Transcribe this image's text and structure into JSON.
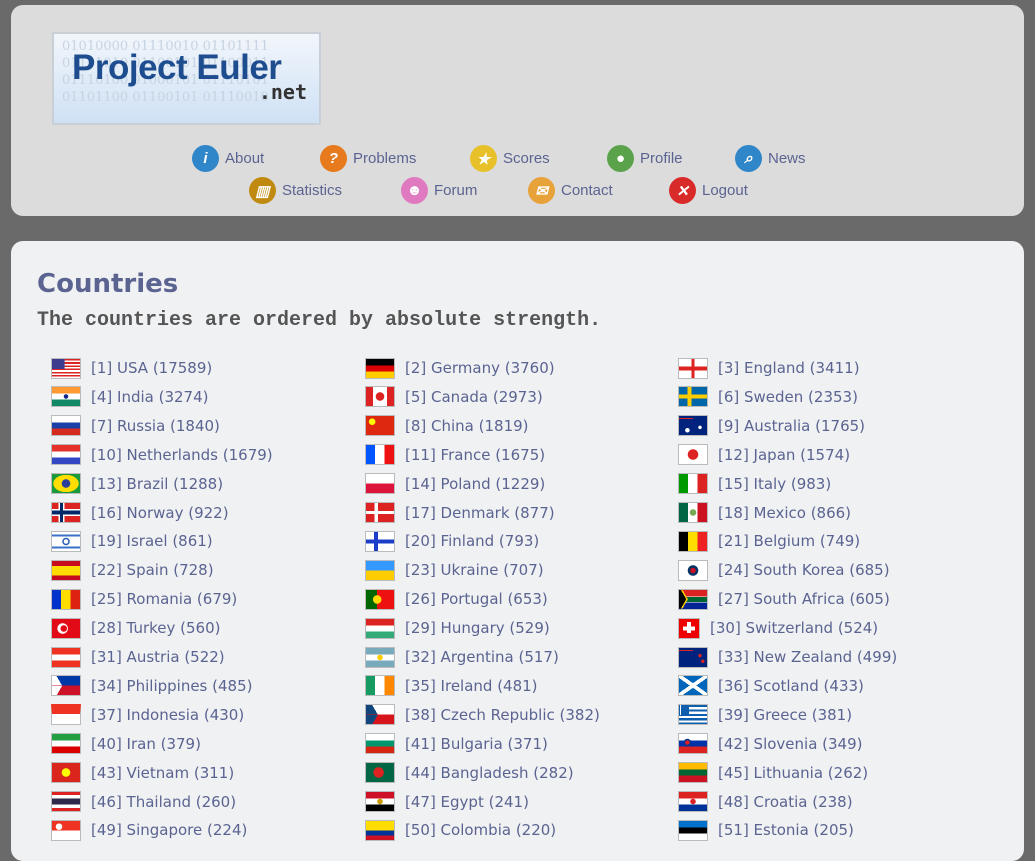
{
  "logo": {
    "title": "Project Euler",
    "suffix": ".net",
    "binary": "01010000 01110010 01101111\n01101010 01100101 01100011\n01110100 01000101 01110101\n01101100 01100101 01110010"
  },
  "nav": [
    {
      "label": "About",
      "icon": "info-icon",
      "color": "#2f86c8",
      "glyph": "i"
    },
    {
      "label": "Problems",
      "icon": "question-icon",
      "color": "#e67a1c",
      "glyph": "?"
    },
    {
      "label": "Scores",
      "icon": "star-icon",
      "color": "#e8c12a",
      "glyph": "★"
    },
    {
      "label": "Profile",
      "icon": "user-icon",
      "color": "#5aa34a",
      "glyph": "●"
    },
    {
      "label": "News",
      "icon": "magnifier-icon",
      "color": "#2f86c8",
      "glyph": "⌕"
    },
    {
      "label": "Statistics",
      "icon": "chart-icon",
      "color": "#c08a10",
      "glyph": "▥"
    },
    {
      "label": "Forum",
      "icon": "users-icon",
      "color": "#e07ac0",
      "glyph": "☻"
    },
    {
      "label": "Contact",
      "icon": "envelope-icon",
      "color": "#e8a23a",
      "glyph": "✉"
    },
    {
      "label": "Logout",
      "icon": "close-icon",
      "color": "#d92a2a",
      "glyph": "✕"
    }
  ],
  "page": {
    "title": "Countries",
    "subtitle": "The countries are ordered by absolute strength."
  },
  "countries": [
    {
      "text": "[1] USA (17589)",
      "flag": "us"
    },
    {
      "text": "[2] Germany (3760)",
      "flag": "de"
    },
    {
      "text": "[3] England (3411)",
      "flag": "eng"
    },
    {
      "text": "[4] India (3274)",
      "flag": "in"
    },
    {
      "text": "[5] Canada (2973)",
      "flag": "ca"
    },
    {
      "text": "[6] Sweden (2353)",
      "flag": "se"
    },
    {
      "text": "[7] Russia (1840)",
      "flag": "ru"
    },
    {
      "text": "[8] China (1819)",
      "flag": "cn"
    },
    {
      "text": "[9] Australia (1765)",
      "flag": "au"
    },
    {
      "text": "[10] Netherlands (1679)",
      "flag": "nl"
    },
    {
      "text": "[11] France (1675)",
      "flag": "fr"
    },
    {
      "text": "[12] Japan (1574)",
      "flag": "jp"
    },
    {
      "text": "[13] Brazil (1288)",
      "flag": "br"
    },
    {
      "text": "[14] Poland (1229)",
      "flag": "pl"
    },
    {
      "text": "[15] Italy (983)",
      "flag": "it"
    },
    {
      "text": "[16] Norway (922)",
      "flag": "no"
    },
    {
      "text": "[17] Denmark (877)",
      "flag": "dk"
    },
    {
      "text": "[18] Mexico (866)",
      "flag": "mx"
    },
    {
      "text": "[19] Israel (861)",
      "flag": "il"
    },
    {
      "text": "[20] Finland (793)",
      "flag": "fi"
    },
    {
      "text": "[21] Belgium (749)",
      "flag": "be"
    },
    {
      "text": "[22] Spain (728)",
      "flag": "es"
    },
    {
      "text": "[23] Ukraine (707)",
      "flag": "ua"
    },
    {
      "text": "[24] South Korea (685)",
      "flag": "kr"
    },
    {
      "text": "[25] Romania (679)",
      "flag": "ro"
    },
    {
      "text": "[26] Portugal (653)",
      "flag": "pt"
    },
    {
      "text": "[27] South Africa (605)",
      "flag": "za"
    },
    {
      "text": "[28] Turkey (560)",
      "flag": "tr"
    },
    {
      "text": "[29] Hungary (529)",
      "flag": "hu"
    },
    {
      "text": "[30] Switzerland (524)",
      "flag": "ch"
    },
    {
      "text": "[31] Austria (522)",
      "flag": "at"
    },
    {
      "text": "[32] Argentina (517)",
      "flag": "ar"
    },
    {
      "text": "[33] New Zealand (499)",
      "flag": "nz"
    },
    {
      "text": "[34] Philippines (485)",
      "flag": "ph"
    },
    {
      "text": "[35] Ireland (481)",
      "flag": "ie"
    },
    {
      "text": "[36] Scotland (433)",
      "flag": "sco"
    },
    {
      "text": "[37] Indonesia (430)",
      "flag": "id"
    },
    {
      "text": "[38] Czech Republic (382)",
      "flag": "cz"
    },
    {
      "text": "[39] Greece (381)",
      "flag": "gr"
    },
    {
      "text": "[40] Iran (379)",
      "flag": "ir"
    },
    {
      "text": "[41] Bulgaria (371)",
      "flag": "bg"
    },
    {
      "text": "[42] Slovenia (349)",
      "flag": "si"
    },
    {
      "text": "[43] Vietnam (311)",
      "flag": "vn"
    },
    {
      "text": "[44] Bangladesh (282)",
      "flag": "bd"
    },
    {
      "text": "[45] Lithuania (262)",
      "flag": "lt"
    },
    {
      "text": "[46] Thailand (260)",
      "flag": "th"
    },
    {
      "text": "[47] Egypt (241)",
      "flag": "eg"
    },
    {
      "text": "[48] Croatia (238)",
      "flag": "hr"
    },
    {
      "text": "[49] Singapore (224)",
      "flag": "sg"
    },
    {
      "text": "[50] Colombia (220)",
      "flag": "co"
    },
    {
      "text": "[51] Estonia (205)",
      "flag": "ee"
    }
  ]
}
